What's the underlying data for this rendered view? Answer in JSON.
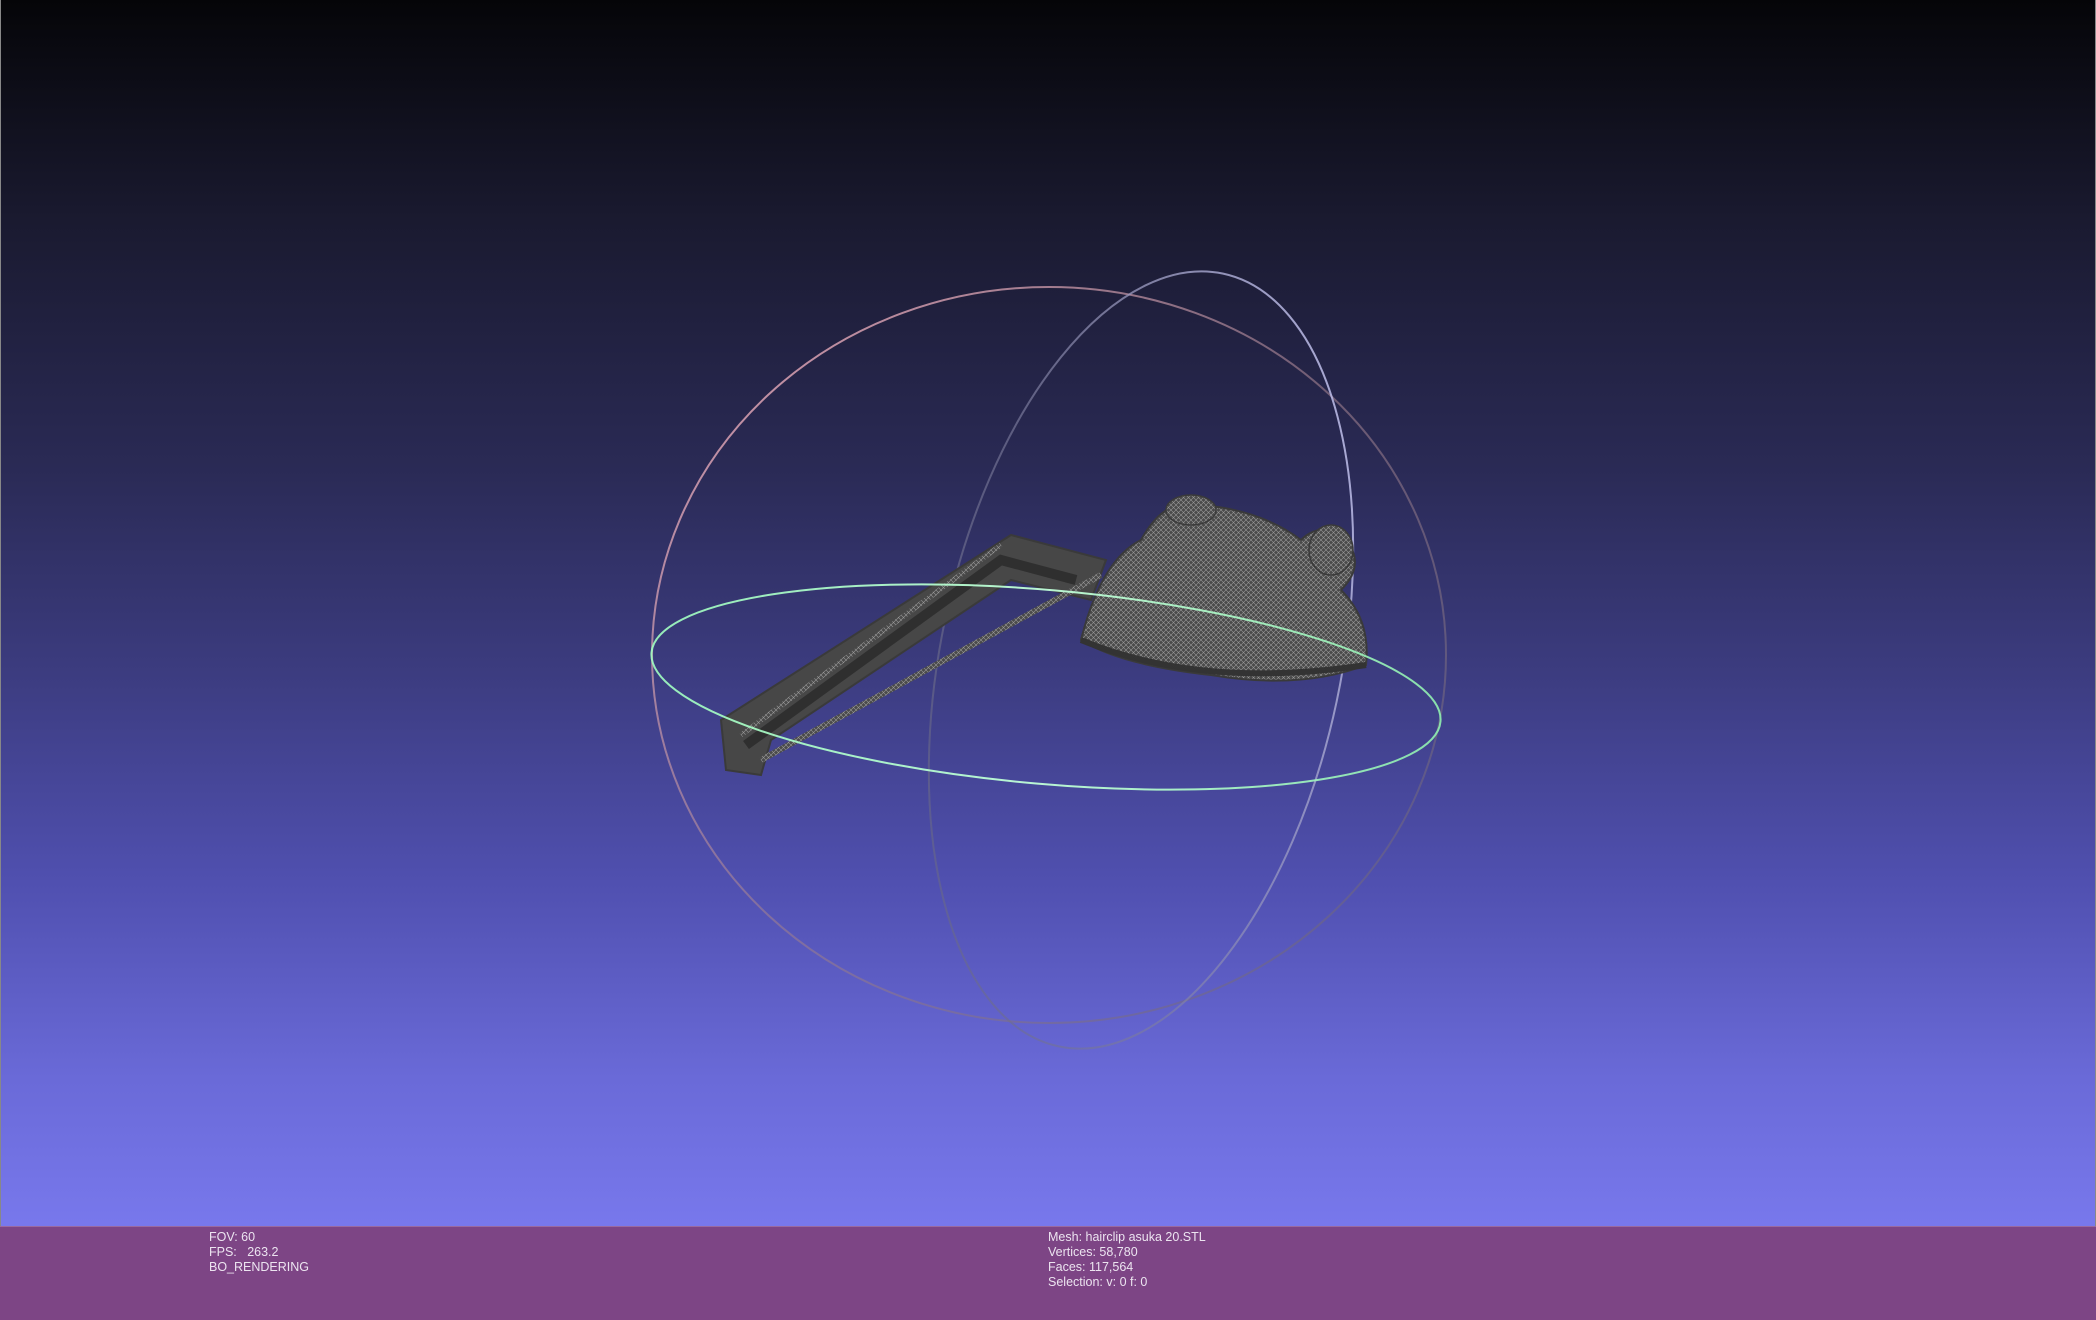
{
  "viewport": {
    "background_top": "#050508",
    "background_bottom": "#7878ec",
    "trackball_colors": {
      "x_ring": "#c0c0ff",
      "y_ring": "#ffb0c0",
      "z_ring": "#a8ffc0"
    },
    "mesh_color": "#505050"
  },
  "info_left": {
    "fov_label": "FOV: 60",
    "fps_label": "FPS:   263.2",
    "render_mode": "BO_RENDERING"
  },
  "info_right": {
    "mesh_label": "Mesh: hairclip asuka 20.STL",
    "vertices_label": "Vertices: 58,780",
    "faces_label": "Faces: 117,564",
    "selection_label": "Selection: v: 0 f: 0"
  },
  "infobar_color": "#7d4585"
}
